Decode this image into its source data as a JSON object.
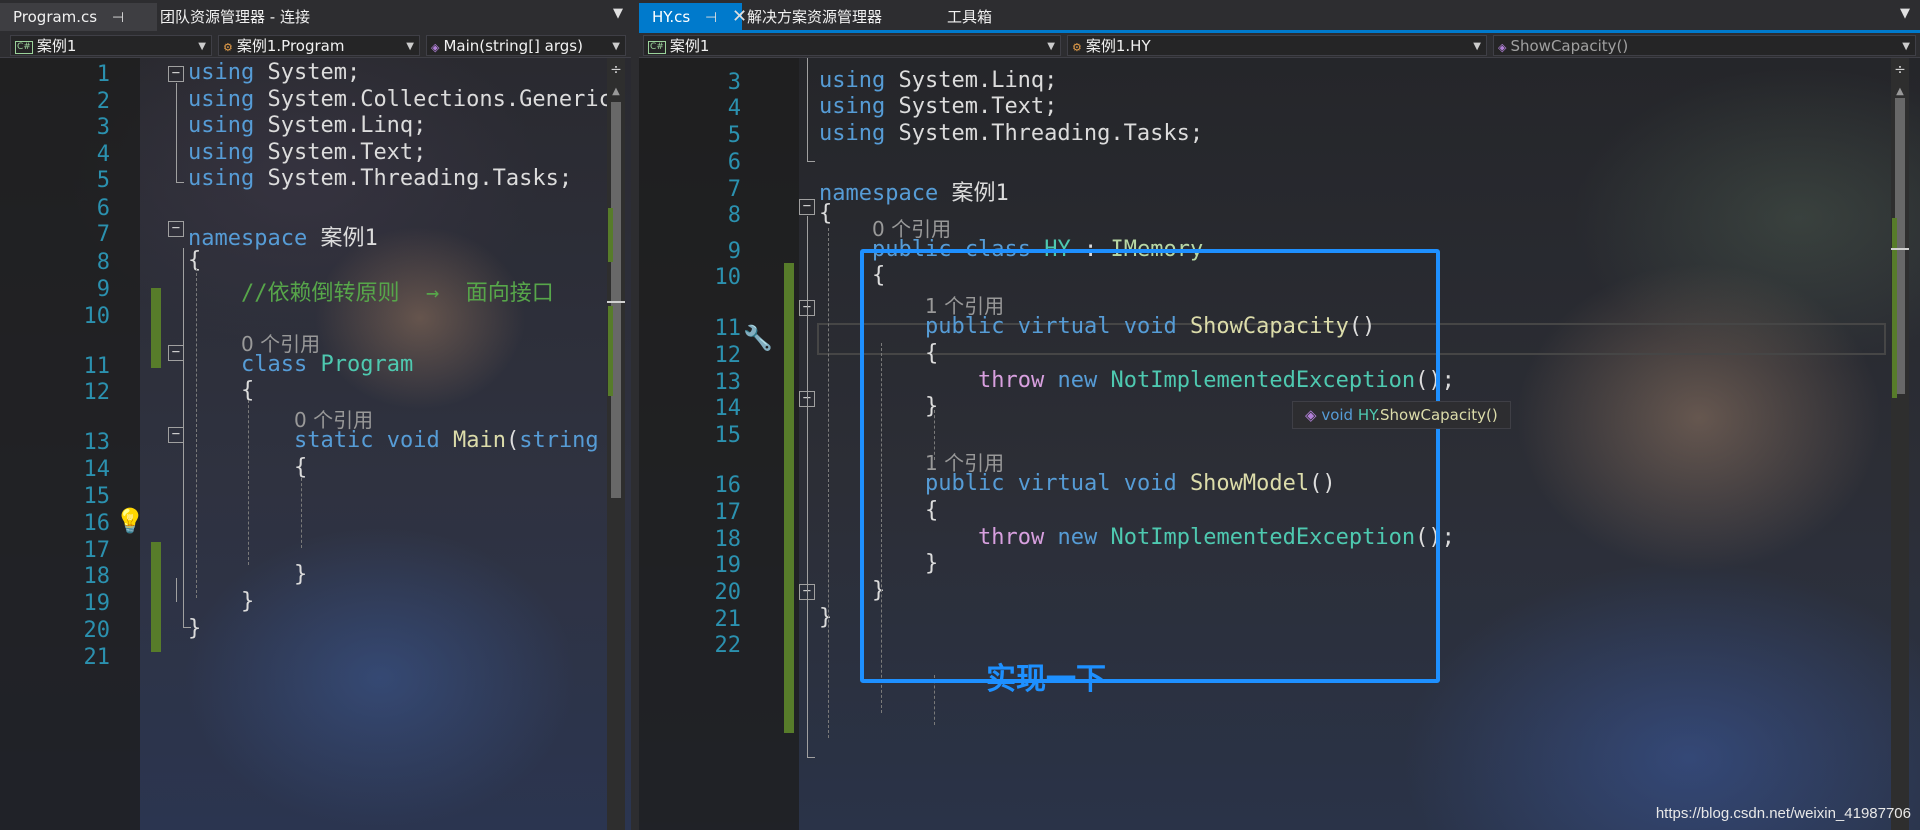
{
  "left": {
    "tabs": [
      {
        "label": "Program.cs",
        "pin": "⊣",
        "close": "✕"
      },
      {
        "label": "团队资源管理器 - 连接"
      }
    ],
    "nav": {
      "project": "案例1",
      "class": "案例1.Program",
      "member": "Main(string[] args)"
    },
    "lines": [
      {
        "n": "1",
        "segs": [
          [
            "kw",
            "using"
          ],
          [
            "",
            " System;"
          ]
        ]
      },
      {
        "n": "2",
        "segs": [
          [
            "kw",
            "using"
          ],
          [
            "",
            " System.Collections.Generic"
          ]
        ]
      },
      {
        "n": "3",
        "segs": [
          [
            "kw",
            "using"
          ],
          [
            "",
            " System.Linq;"
          ]
        ]
      },
      {
        "n": "4",
        "segs": [
          [
            "kw",
            "using"
          ],
          [
            "",
            " System.Text;"
          ]
        ]
      },
      {
        "n": "5",
        "segs": [
          [
            "kw",
            "using"
          ],
          [
            "",
            " System.Threading.Tasks;"
          ]
        ]
      },
      {
        "n": "6",
        "segs": []
      },
      {
        "n": "7",
        "segs": [
          [
            "kw",
            "namespace"
          ],
          [
            "",
            " 案例1"
          ]
        ]
      },
      {
        "n": "8",
        "segs": [
          [
            "",
            "{"
          ]
        ]
      },
      {
        "n": "9",
        "segs": [
          [
            "cm",
            "//依赖倒转原则  →  面向接口"
          ]
        ]
      },
      {
        "n": "10",
        "segs": []
      },
      {
        "n": "11",
        "hint": "0 个引用",
        "segs": [
          [
            "kw",
            "class"
          ],
          [
            "",
            " "
          ],
          [
            "ty",
            "Program"
          ]
        ]
      },
      {
        "n": "12",
        "segs": [
          [
            "",
            "{"
          ]
        ]
      },
      {
        "n": "13",
        "hint": "0 个引用",
        "segs": [
          [
            "kw",
            "static"
          ],
          [
            "",
            " "
          ],
          [
            "kw",
            "void"
          ],
          [
            "",
            " "
          ],
          [
            "fn",
            "Main"
          ],
          [
            "",
            "("
          ],
          [
            "kw",
            "string"
          ]
        ]
      },
      {
        "n": "14",
        "segs": [
          [
            "",
            "{"
          ]
        ]
      },
      {
        "n": "15",
        "segs": []
      },
      {
        "n": "16",
        "segs": []
      },
      {
        "n": "17",
        "segs": []
      },
      {
        "n": "18",
        "segs": [
          [
            "",
            "}"
          ]
        ]
      },
      {
        "n": "19",
        "segs": [
          [
            "",
            "}"
          ]
        ]
      },
      {
        "n": "20",
        "segs": [
          [
            "",
            "}"
          ]
        ]
      },
      {
        "n": "21",
        "segs": []
      }
    ]
  },
  "right": {
    "tabs": [
      {
        "label": "HY.cs",
        "pin": "⊣",
        "close": "✕"
      },
      {
        "label": "解决方案资源管理器"
      },
      {
        "label": "工具箱"
      }
    ],
    "nav": {
      "project": "案例1",
      "class": "案例1.HY",
      "member": "ShowCapacity()"
    },
    "lines": [
      {
        "n": "3",
        "segs": [
          [
            "kw",
            "using"
          ],
          [
            "",
            " System.Linq;"
          ]
        ]
      },
      {
        "n": "4",
        "segs": [
          [
            "kw",
            "using"
          ],
          [
            "",
            " System.Text;"
          ]
        ]
      },
      {
        "n": "5",
        "segs": [
          [
            "kw",
            "using"
          ],
          [
            "",
            " System.Threading.Tasks;"
          ]
        ]
      },
      {
        "n": "6",
        "segs": []
      },
      {
        "n": "7",
        "segs": [
          [
            "kw",
            "namespace"
          ],
          [
            "",
            " 案例1"
          ]
        ]
      },
      {
        "n": "8",
        "segs": [
          [
            "",
            "{"
          ]
        ]
      },
      {
        "n": "9",
        "hint": "0 个引用",
        "segs": [
          [
            "kw",
            "public"
          ],
          [
            "",
            " "
          ],
          [
            "kw",
            "class"
          ],
          [
            "",
            " "
          ],
          [
            "ty",
            "HY"
          ],
          [
            "",
            " : "
          ],
          [
            "ifc",
            "IMemory"
          ]
        ]
      },
      {
        "n": "10",
        "segs": [
          [
            "",
            "{"
          ]
        ]
      },
      {
        "n": "11",
        "hint": "1 个引用",
        "segs": [
          [
            "kw",
            "public"
          ],
          [
            "",
            " "
          ],
          [
            "kw",
            "virtual"
          ],
          [
            "",
            " "
          ],
          [
            "kw",
            "void"
          ],
          [
            "",
            " "
          ],
          [
            "fn",
            "ShowCapacity"
          ],
          [
            "",
            "()"
          ]
        ]
      },
      {
        "n": "12",
        "segs": [
          [
            "",
            "{"
          ]
        ]
      },
      {
        "n": "13",
        "segs": [
          [
            "ctl",
            "throw"
          ],
          [
            "",
            " "
          ],
          [
            "kw",
            "new"
          ],
          [
            "",
            " "
          ],
          [
            "ty",
            "NotImplementedException"
          ],
          [
            "",
            "();"
          ]
        ]
      },
      {
        "n": "14",
        "segs": [
          [
            "",
            "}"
          ]
        ]
      },
      {
        "n": "15",
        "segs": []
      },
      {
        "n": "16",
        "hint": "1 个引用",
        "segs": [
          [
            "kw",
            "public"
          ],
          [
            "",
            " "
          ],
          [
            "kw",
            "virtual"
          ],
          [
            "",
            " "
          ],
          [
            "kw",
            "void"
          ],
          [
            "",
            " "
          ],
          [
            "fn",
            "ShowModel"
          ],
          [
            "",
            "()"
          ]
        ]
      },
      {
        "n": "17",
        "segs": [
          [
            "",
            "{"
          ]
        ]
      },
      {
        "n": "18",
        "segs": [
          [
            "ctl",
            "throw"
          ],
          [
            "",
            " "
          ],
          [
            "kw",
            "new"
          ],
          [
            "",
            " "
          ],
          [
            "ty",
            "NotImplementedException"
          ],
          [
            "",
            "();"
          ]
        ]
      },
      {
        "n": "19",
        "segs": [
          [
            "",
            "}"
          ]
        ]
      },
      {
        "n": "20",
        "segs": [
          [
            "",
            "}"
          ]
        ]
      },
      {
        "n": "21",
        "segs": [
          [
            "",
            "}"
          ]
        ]
      },
      {
        "n": "22",
        "segs": []
      }
    ],
    "tooltip": {
      "prefix": "void ",
      "type": "HY",
      "rest": ".ShowCapacity()"
    },
    "annotation": "实现一下"
  },
  "watermark": "https://blog.csdn.net/weixin_41987706",
  "icons": {
    "lightbulb": "lightbulb-icon",
    "quick_action": "wrench-brush-icon",
    "cs_file": "csharp-project-icon",
    "class": "class-icon",
    "method": "method-icon"
  },
  "colors": {
    "accent": "#007acc",
    "keyword": "#569cd6",
    "type": "#4ec9b0",
    "method": "#dcdcaa",
    "comment": "#57a64a",
    "control": "#d8a0df",
    "interface": "#b8d7a3",
    "line_number": "#2b91af",
    "annotation": "#1e90ff"
  }
}
